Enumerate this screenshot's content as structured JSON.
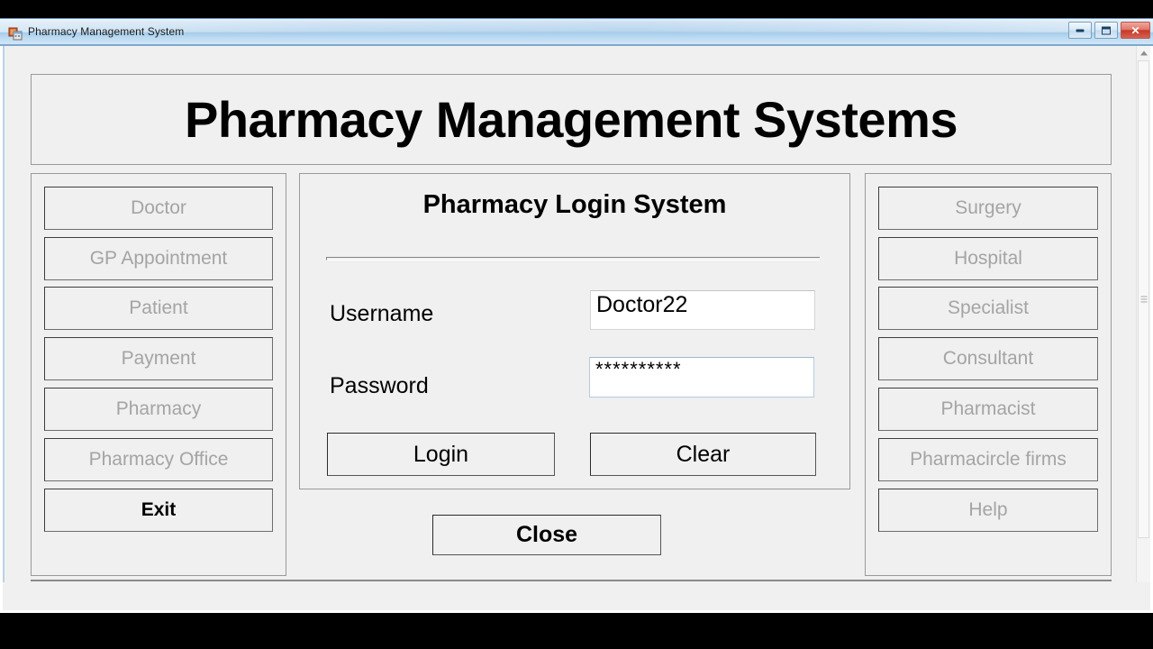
{
  "window": {
    "title": "Pharmacy Management System",
    "icon": "form-designer-icon",
    "controls": {
      "minimize": "minimize-icon",
      "maximize": "maximize-icon",
      "close": "✕"
    }
  },
  "header": {
    "title": "Pharmacy Management Systems"
  },
  "left_panel": {
    "buttons": [
      {
        "label": "Doctor",
        "enabled": false
      },
      {
        "label": "GP Appointment",
        "enabled": false
      },
      {
        "label": "Patient",
        "enabled": false
      },
      {
        "label": "Payment",
        "enabled": false
      },
      {
        "label": "Pharmacy",
        "enabled": false
      },
      {
        "label": "Pharmacy Office",
        "enabled": false
      },
      {
        "label": "Exit",
        "enabled": true
      }
    ]
  },
  "right_panel": {
    "buttons": [
      {
        "label": "Surgery",
        "enabled": false
      },
      {
        "label": "Hospital",
        "enabled": false
      },
      {
        "label": "Specialist",
        "enabled": false
      },
      {
        "label": "Consultant",
        "enabled": false
      },
      {
        "label": "Pharmacist",
        "enabled": false
      },
      {
        "label": "Pharmacircle firms",
        "enabled": false
      },
      {
        "label": "Help",
        "enabled": false
      }
    ]
  },
  "login": {
    "group_title": "Pharmacy Login System",
    "username_label": "Username",
    "username_value": "Doctor22",
    "username_placeholder": "",
    "password_label": "Password",
    "password_value": "**********",
    "password_placeholder": "",
    "login_button": "Login",
    "clear_button": "Clear"
  },
  "close_button": {
    "label": "Close"
  },
  "status": {
    "value": "",
    "placeholder": ""
  },
  "colors": {
    "form_background": "#f0f0f0",
    "titlebar_blue": "#a6cbe9",
    "close_button_red": "#c8372a",
    "disabled_text": "#a4a4a4",
    "enabled_text": "#000000",
    "panel_border": "#9a9a9a"
  }
}
